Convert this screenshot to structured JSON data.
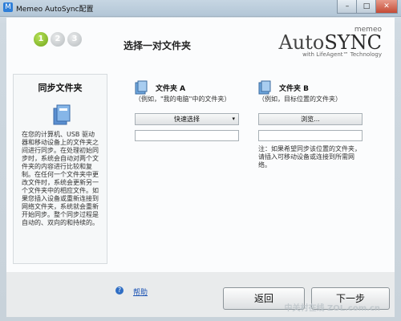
{
  "window": {
    "title": "Memeo AutoSync配置",
    "controls": [
      "–",
      "□",
      "✕"
    ]
  },
  "header": {
    "steps": [
      {
        "label": "1",
        "active": true
      },
      {
        "label": "2",
        "active": false
      },
      {
        "label": "3",
        "active": false
      }
    ],
    "title": "选择一对文件夹",
    "logo": {
      "small": "memeo",
      "main_auto": "Auto",
      "main_sync": "SYNC",
      "tagline": "with LifeAgent™ Technology"
    }
  },
  "left_panel": {
    "title": "同步文件夹",
    "description": "在您的计算机、USB 驱动器和移动设备上的文件夹之间进行同步。在处理初始同步时，系统会自动对两个文件夹的内容进行比较和复制。在任何一个文件夹中更改文件时，系统会更新另一个文件夹中的相应文件。如果您插入设备或重新连接到网络文件夹，系统就会重新开始同步。整个同步过程是自动的、双向的和持续的。"
  },
  "folder_a": {
    "title": "文件夹 A",
    "subtitle": "（例如，\"我的电脑\"中的文件夹）",
    "button": "快速选择",
    "path": ""
  },
  "folder_b": {
    "title": "文件夹 B",
    "subtitle": "（例如，目标位置的文件夹）",
    "button": "浏览...",
    "path": ""
  },
  "note": "注：如果希望同步该位置的文件夹，请插入可移动设备或连接到所需网络。",
  "footer": {
    "help": "帮助",
    "back": "返回",
    "next": "下一步"
  },
  "watermark": "中关村在线 ZOL.com.cn",
  "colors": {
    "accent_green": "#7db31f",
    "link_blue": "#1a52b3"
  }
}
